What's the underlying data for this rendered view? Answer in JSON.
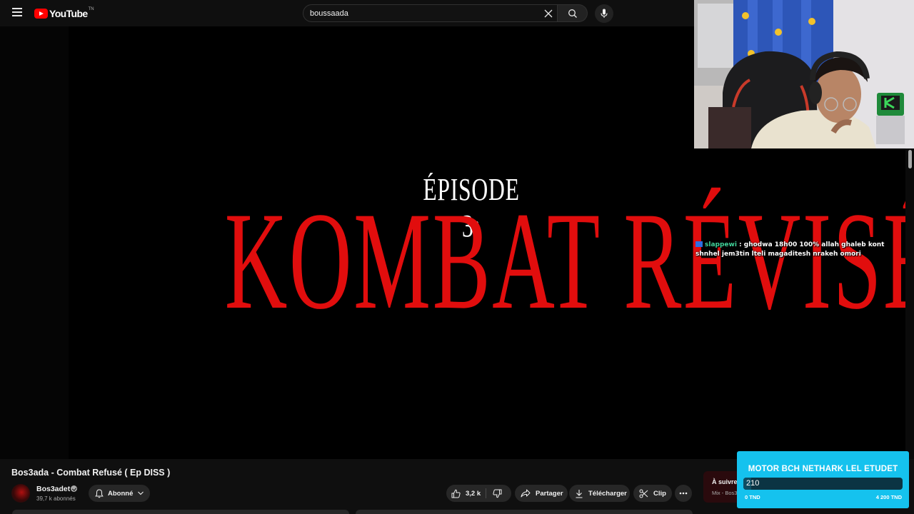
{
  "header": {
    "logo_text": "YouTube",
    "logo_superscript": "TN",
    "search_value": "boussaada"
  },
  "video": {
    "episode_label": "ÉPISODE 3:",
    "title_card": "KOMBAT RÉVISÉ"
  },
  "chat": {
    "user": "slappewi",
    "message": ": ghodwa 18h00 100% allah ghaleb kont shnhel jem3tin lteli magaditesh nrakeh omori"
  },
  "details": {
    "title": "Bos3ada - Combat Refusé ( Ep DISS )",
    "channel_name": "Bos3adet",
    "subscribers": "39,7 k abonnés",
    "subscribe_label": "Abonné",
    "likes": "3,2 k",
    "share_label": "Partager",
    "download_label": "Télécharger",
    "clip_label": "Clip"
  },
  "up_next": {
    "title": "À suivre",
    "subtitle": "Mix - Bos3"
  },
  "donation": {
    "title": "MOTOR BCH NETHARK LEL ETUDET",
    "current": "210",
    "min_label": "0 TND",
    "max_label": "4 200 TND",
    "progress": 0.05
  },
  "colors": {
    "accent": "#ff0000",
    "title_card_red": "#e10d0d",
    "donation_bg": "#15c2ee",
    "chat_user": "#41d39a"
  },
  "icons": [
    "menu-icon",
    "youtube-logo-icon",
    "clear-icon",
    "search-icon",
    "mic-icon",
    "verified-icon",
    "bell-icon",
    "chevron-down-icon",
    "thumbs-up-icon",
    "thumbs-down-icon",
    "share-icon",
    "download-icon",
    "scissors-icon",
    "more-icon"
  ]
}
